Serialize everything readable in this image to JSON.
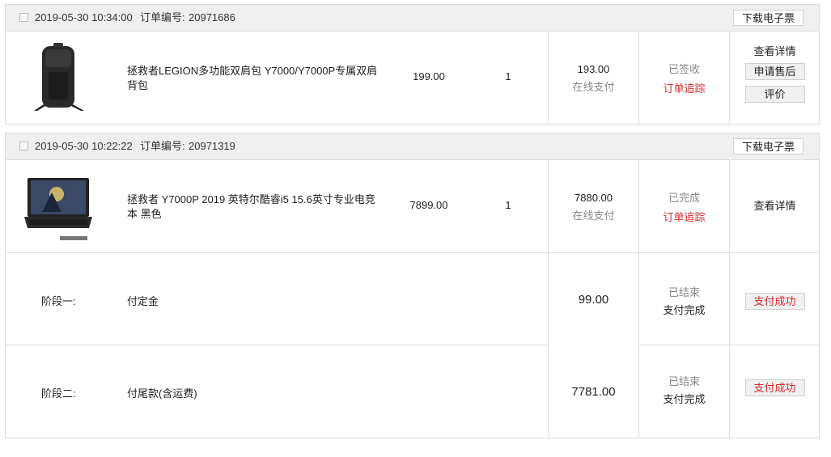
{
  "orders": [
    {
      "date": "2019-05-30 10:34:00",
      "order_label": "订单编号:",
      "order_no": "20971686",
      "e_invoice": "下载电子票",
      "product": {
        "name": "拯救者LEGION多功能双肩包 Y7000/Y7000P专属双肩背包",
        "image": "backpack-image",
        "unit_price": "199.00",
        "quantity": "1"
      },
      "paid": "193.00",
      "pay_method": "在线支付",
      "status": "已签收",
      "track": "订单追踪",
      "actions": [
        "查看详情",
        "申请售后",
        "评价"
      ]
    },
    {
      "date": "2019-05-30 10:22:22",
      "order_label": "订单编号:",
      "order_no": "20971319",
      "e_invoice": "下载电子票",
      "product": {
        "name": "拯救者 Y7000P 2019 英特尔酷睿i5 15.6英寸专业电竞本 黑色",
        "image": "laptop-image",
        "unit_price": "7899.00",
        "quantity": "1"
      },
      "paid": "7880.00",
      "pay_method": "在线支付",
      "status": "已完成",
      "track": "订单追踪",
      "actions": [
        "查看详情"
      ],
      "stages": [
        {
          "label": "阶段一:",
          "desc": "付定金",
          "amount": "99.00",
          "status": "已结束",
          "pay_status": "支付完成",
          "button": "支付成功"
        },
        {
          "label": "阶段二:",
          "desc": "付尾款(含运费)",
          "amount": "7781.00",
          "status": "已结束",
          "pay_status": "支付完成",
          "button": "支付成功"
        }
      ]
    }
  ],
  "colors": {
    "accent_red": "#d42a2a",
    "header_bg": "#efefef",
    "border": "#dcdcdc"
  }
}
